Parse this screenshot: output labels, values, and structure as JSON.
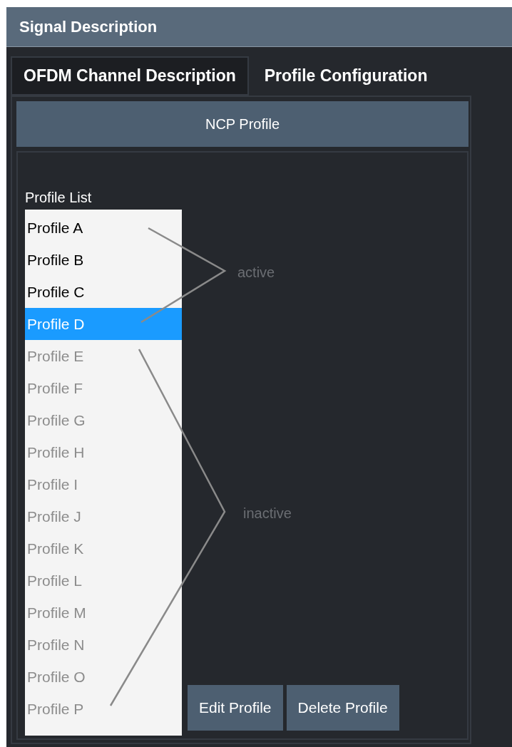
{
  "window": {
    "title": "Signal Description"
  },
  "tabs": [
    {
      "label": "OFDM Channel Description",
      "selected": false
    },
    {
      "label": "Profile Configuration",
      "selected": true
    }
  ],
  "ncp_button": "NCP Profile",
  "profile_list": {
    "label": "Profile List",
    "items": [
      {
        "label": "Profile A",
        "active": true,
        "selected": false
      },
      {
        "label": "Profile B",
        "active": true,
        "selected": false
      },
      {
        "label": "Profile C",
        "active": true,
        "selected": false
      },
      {
        "label": "Profile D",
        "active": true,
        "selected": true
      },
      {
        "label": "Profile E",
        "active": false,
        "selected": false
      },
      {
        "label": "Profile F",
        "active": false,
        "selected": false
      },
      {
        "label": "Profile G",
        "active": false,
        "selected": false
      },
      {
        "label": "Profile H",
        "active": false,
        "selected": false
      },
      {
        "label": "Profile I",
        "active": false,
        "selected": false
      },
      {
        "label": "Profile J",
        "active": false,
        "selected": false
      },
      {
        "label": "Profile K",
        "active": false,
        "selected": false
      },
      {
        "label": "Profile L",
        "active": false,
        "selected": false
      },
      {
        "label": "Profile M",
        "active": false,
        "selected": false
      },
      {
        "label": "Profile N",
        "active": false,
        "selected": false
      },
      {
        "label": "Profile O",
        "active": false,
        "selected": false
      },
      {
        "label": "Profile P",
        "active": false,
        "selected": false
      }
    ]
  },
  "annotations": [
    {
      "label": "active"
    },
    {
      "label": "inactive"
    }
  ],
  "buttons": [
    "Edit Profile",
    "Delete Profile"
  ]
}
